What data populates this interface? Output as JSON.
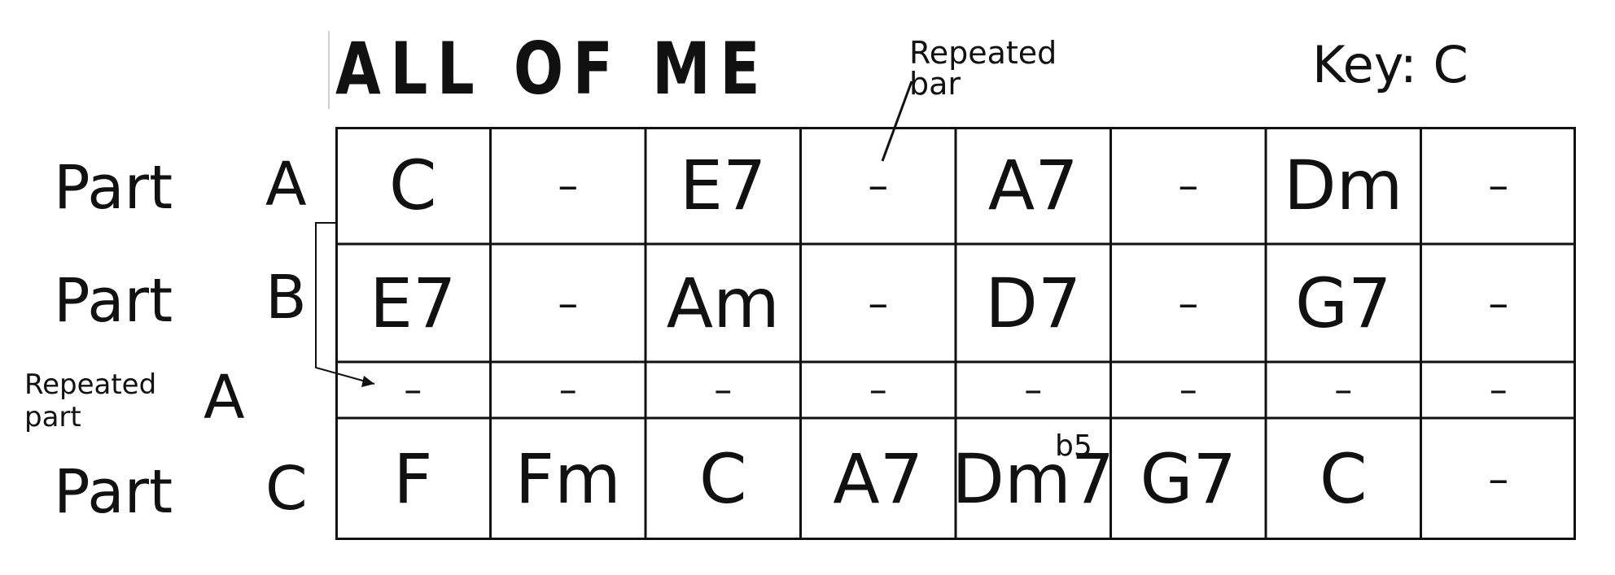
{
  "title": "ALL OF ME",
  "key": "Key: C",
  "annotation": {
    "line1": "Repeated",
    "line2": "bar"
  },
  "rows": [
    {
      "part": "Part",
      "letter": "A",
      "chords": [
        "C",
        "–",
        "E7",
        "–",
        "A7",
        "–",
        "Dm",
        "–"
      ]
    },
    {
      "part": "Part",
      "letter": "B",
      "chords": [
        "E7",
        "–",
        "Am",
        "–",
        "D7",
        "–",
        "G7",
        "–"
      ]
    },
    {
      "part": "Repeated part",
      "letter": "A",
      "chords": [
        "–",
        "–",
        "–",
        "–",
        "–",
        "–",
        "–",
        "–"
      ]
    },
    {
      "part": "Part",
      "letter": "C",
      "chords": [
        "F",
        "Fm",
        "C",
        "A7",
        "Dm7",
        "G7",
        "C",
        "–"
      ]
    }
  ],
  "superscript": "b5"
}
